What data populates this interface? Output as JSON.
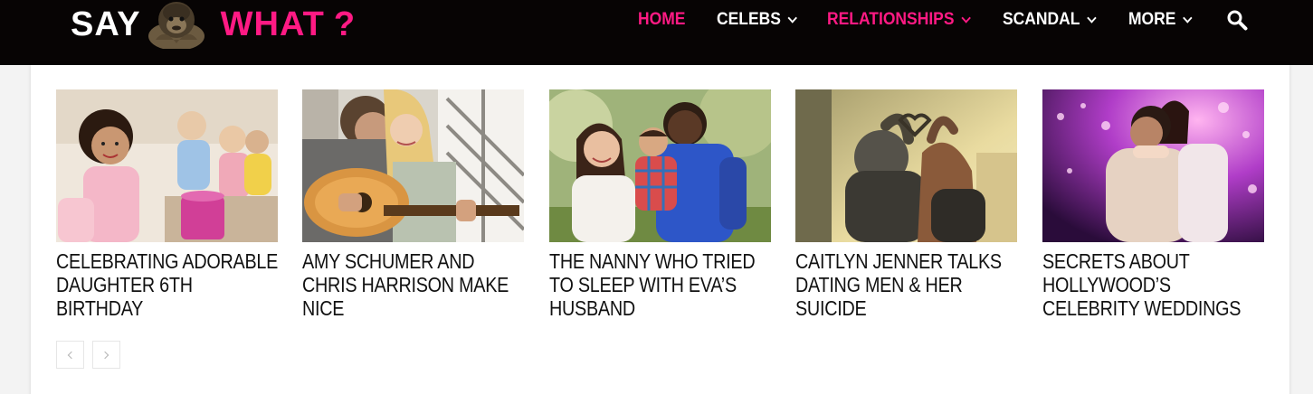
{
  "logo": {
    "word1": "SAY",
    "word2": "WHAT",
    "punct": "?"
  },
  "nav": {
    "items": [
      {
        "label": "HOME",
        "active": true,
        "dropdown": false
      },
      {
        "label": "CELEBS",
        "active": false,
        "dropdown": true
      },
      {
        "label": "RELATIONSHIPS",
        "active": true,
        "dropdown": true
      },
      {
        "label": "SCANDAL",
        "active": false,
        "dropdown": true
      },
      {
        "label": "MORE",
        "active": false,
        "dropdown": true
      }
    ],
    "search_icon": "search-icon"
  },
  "articles": [
    {
      "title": "CELEBRATING ADORABLE DAUGHTER 6TH BIRTHDAY"
    },
    {
      "title": "AMY SCHUMER AND CHRIS HARRISON MAKE NICE"
    },
    {
      "title": "THE NANNY WHO TRIED TO SLEEP WITH EVA’S HUSBAND"
    },
    {
      "title": "CAITLYN JENNER TALKS DATING MEN & HER SUICIDE"
    },
    {
      "title": "SECRETS ABOUT HOLLYWOOD’S CELEBRITY WEDDINGS"
    }
  ],
  "pager": {
    "prev_icon": "chevron-left-icon",
    "next_icon": "chevron-right-icon"
  },
  "colors": {
    "header_bg": "#070404",
    "accent": "#ff1a84",
    "text": "#111111"
  }
}
